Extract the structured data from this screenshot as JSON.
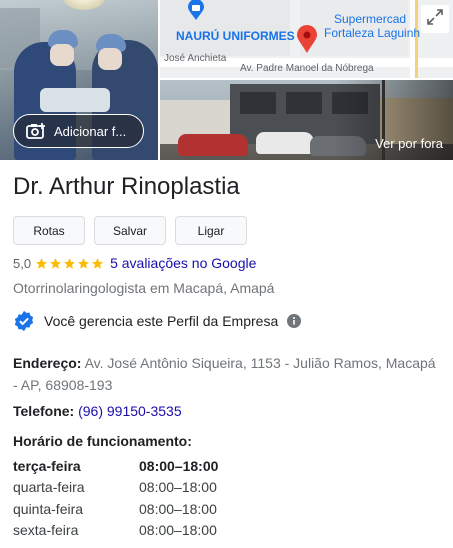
{
  "media": {
    "add_photo_label": "Adicionar f...",
    "street_view_label": "Ver por fora",
    "map": {
      "labels": {
        "supermarket": "Supermercad",
        "fortaleza": "Fortaleza Laguinh",
        "nauru": "NAURÚ UNIFORMES",
        "street_anchieta": "José Anchieta",
        "street_padre": "Av. Padre Manoel da Nóbrega"
      }
    }
  },
  "business": {
    "name": "Dr. Arthur Rinoplastia",
    "actions": [
      {
        "label": "Rotas"
      },
      {
        "label": "Salvar"
      },
      {
        "label": "Ligar"
      }
    ],
    "rating": {
      "score": "5,0",
      "stars": 5,
      "reviews_text": "5 avaliações no Google"
    },
    "category": "Otorrinolaringologista em Macapá, Amapá",
    "managed_text": "Você gerencia este Perfil da Empresa",
    "address": {
      "label": "Endereço:",
      "value": "Av. José Antônio Siqueira, 1153 - Julião Ramos, Macapá - AP, 68908-193"
    },
    "phone": {
      "label": "Telefone:",
      "value": "(96) 99150-3535"
    },
    "hours": {
      "label": "Horário de funcionamento:",
      "rows": [
        {
          "day": "terça-feira",
          "time": "08:00–18:00",
          "today": true
        },
        {
          "day": "quarta-feira",
          "time": "08:00–18:00",
          "today": false
        },
        {
          "day": "quinta-feira",
          "time": "08:00–18:00",
          "today": false
        },
        {
          "day": "sexta-feira",
          "time": "08:00–18:00",
          "today": false
        }
      ]
    }
  },
  "colors": {
    "link": "#1a0dab",
    "star": "#fbbc04",
    "verified": "#1a73e8",
    "map_pin": "#ea4335"
  }
}
